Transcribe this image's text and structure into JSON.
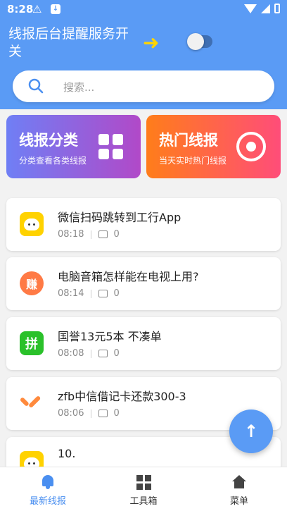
{
  "status_bar": {
    "time": "8:28"
  },
  "service": {
    "title": "线报后台提醒服务开关",
    "toggle_on": false
  },
  "search": {
    "placeholder": "搜索..."
  },
  "categories": [
    {
      "title": "线报分类",
      "subtitle": "分类查看各类线报",
      "icon": "grid-icon"
    },
    {
      "title": "热门线报",
      "subtitle": "当天实时热门线报",
      "icon": "target-icon"
    }
  ],
  "list": [
    {
      "title": "微信扫码跳转到工行App",
      "time": "08:18",
      "comments": "0",
      "icon": "wechat-mascot-icon"
    },
    {
      "title": "电脑音箱怎样能在电视上用?",
      "time": "08:14",
      "comments": "0",
      "icon": "earn-icon",
      "badge_text": "赚"
    },
    {
      "title": "国誉13元5本 不凑单",
      "time": "08:08",
      "comments": "0",
      "icon": "pinduoduo-icon",
      "badge_text": "拼"
    },
    {
      "title": "zfb中信借记卡还款300-3",
      "time": "08:06",
      "comments": "0",
      "icon": "v-logo-icon"
    },
    {
      "title": "10.",
      "time": "",
      "comments": "",
      "icon": "wechat-mascot-icon"
    }
  ],
  "nav": [
    {
      "label": "最新线报",
      "icon": "bell-icon",
      "active": true
    },
    {
      "label": "工具箱",
      "icon": "toolbox-icon",
      "active": false
    },
    {
      "label": "菜单",
      "icon": "home-icon",
      "active": false
    }
  ],
  "colors": {
    "primary": "#5a9bf5",
    "arrow": "#ffd400",
    "card_left": "#8c68df",
    "card_right": "#ff6347"
  }
}
